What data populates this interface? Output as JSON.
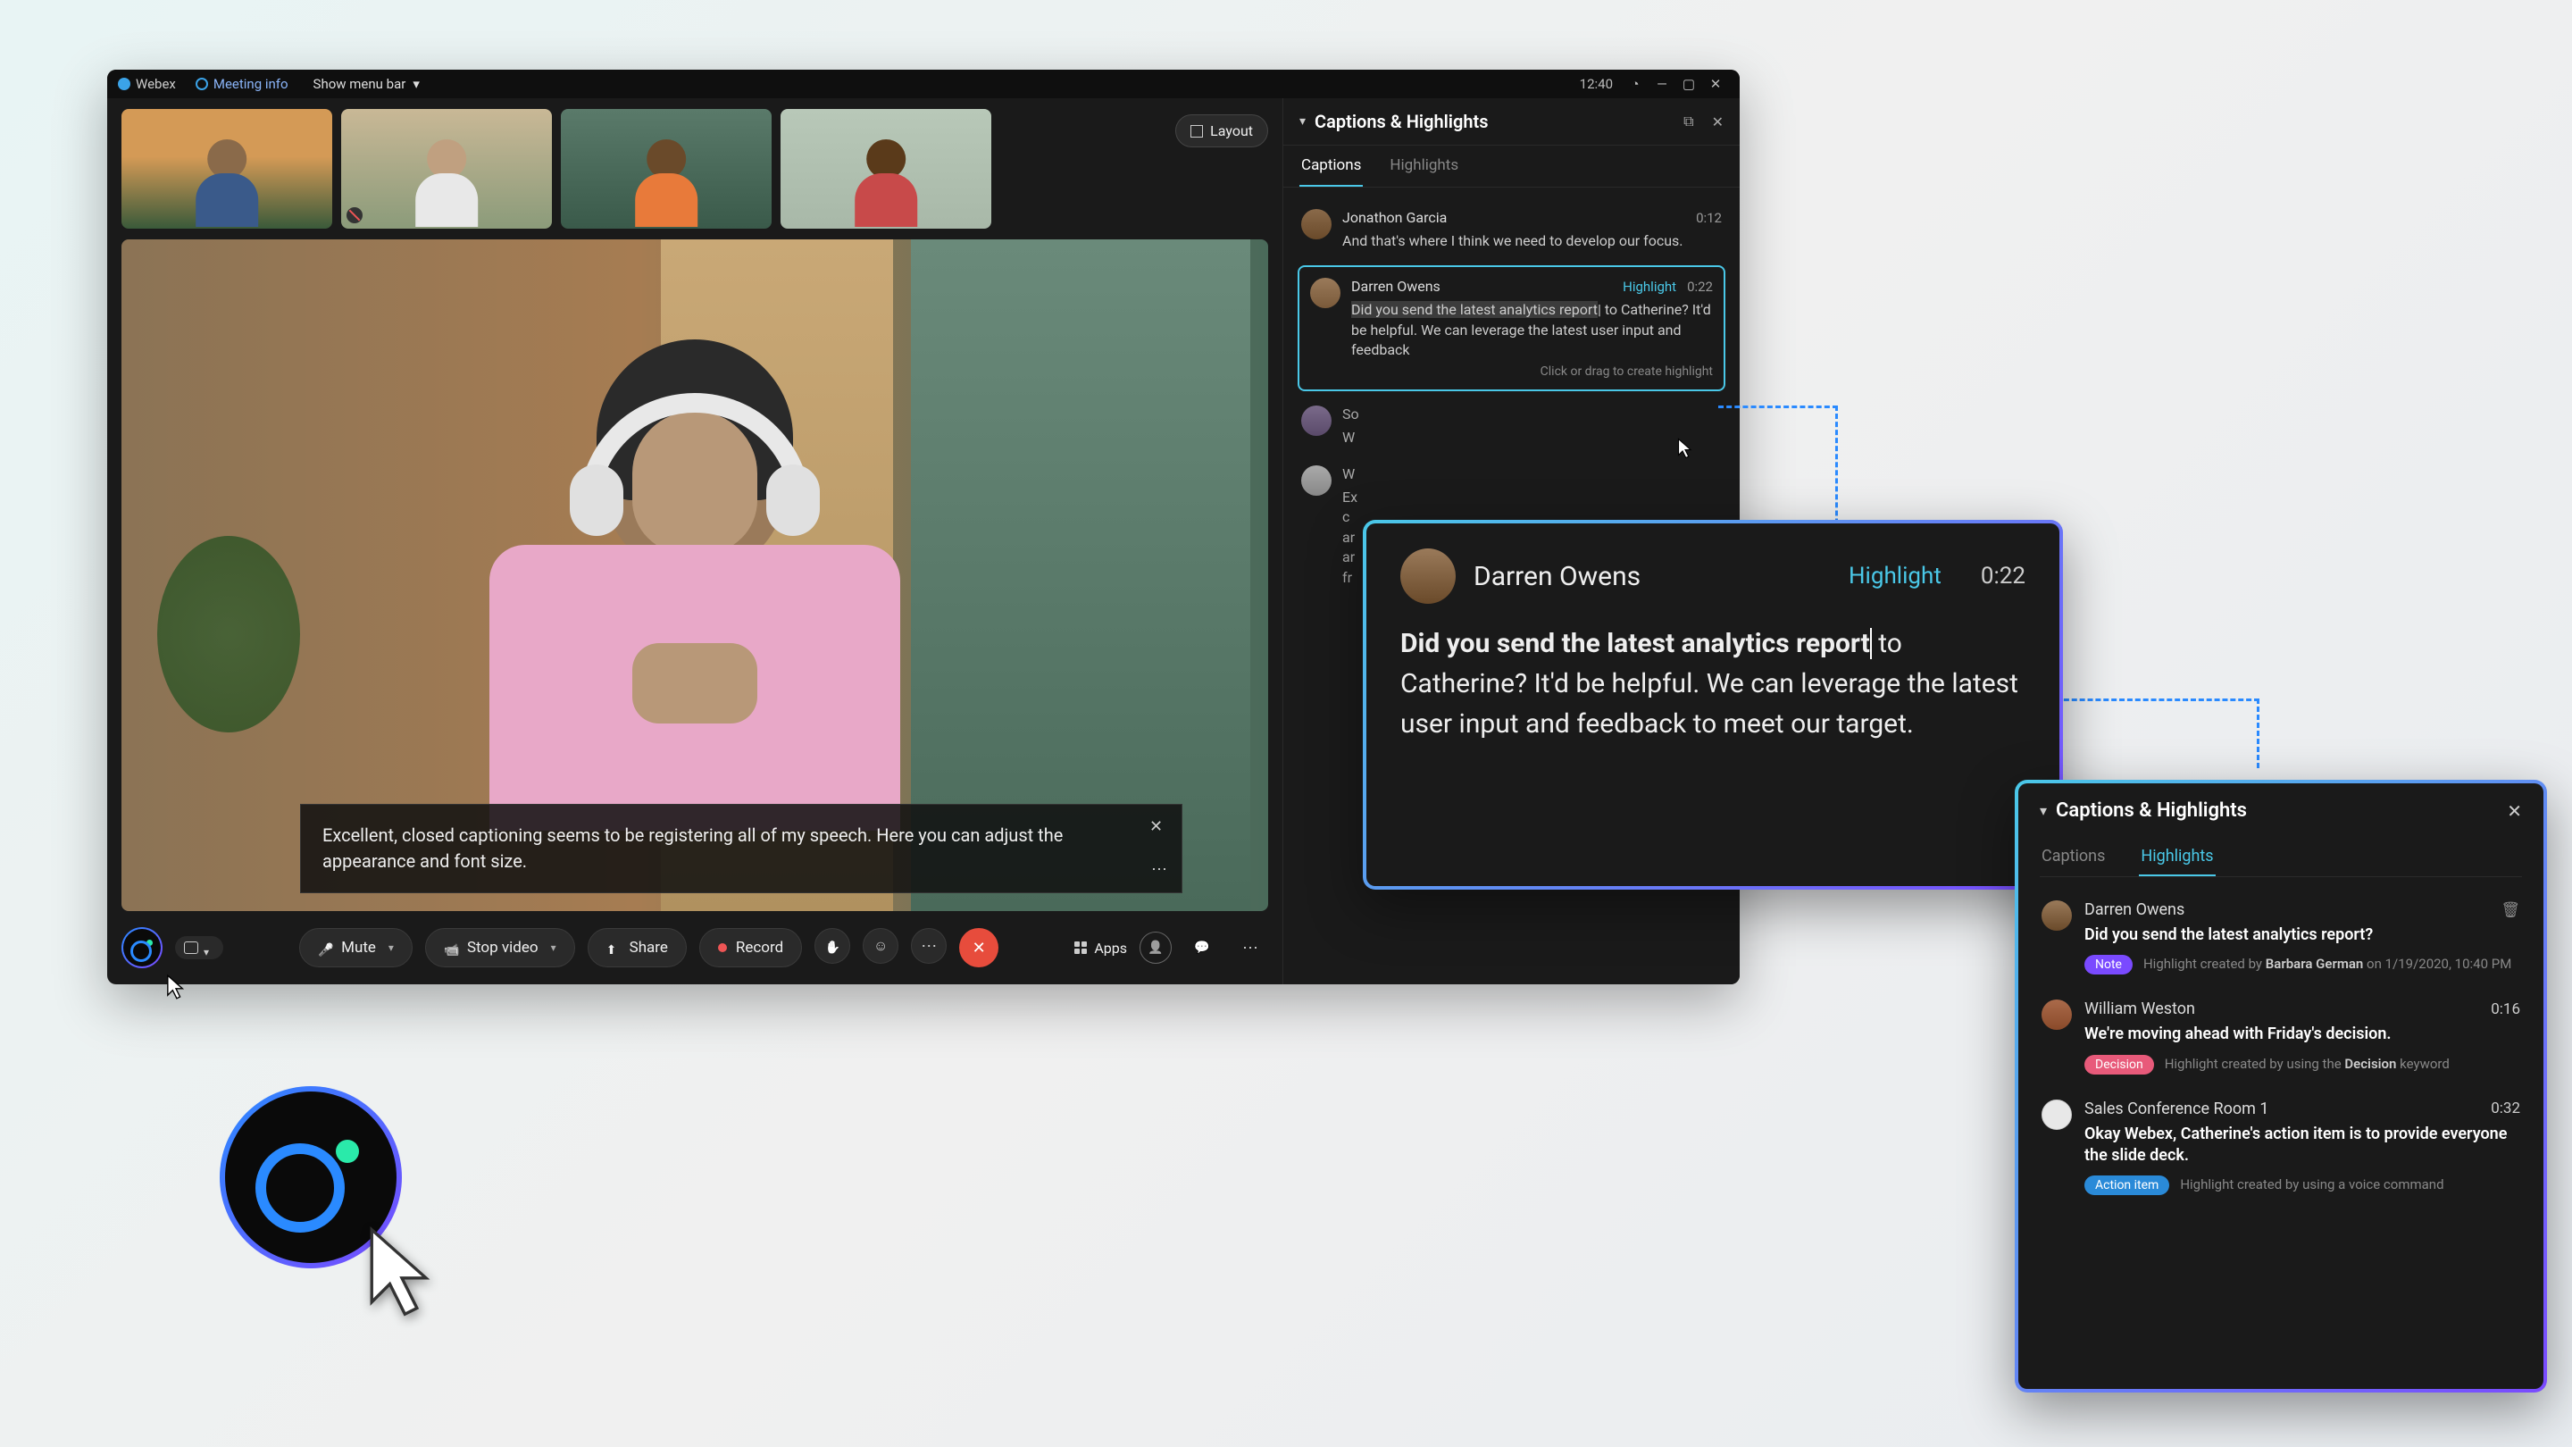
{
  "titlebar": {
    "brand": "Webex",
    "meeting_info": "Meeting info",
    "show_menu": "Show menu bar",
    "time": "12:40"
  },
  "layout_btn": "Layout",
  "caption_live": "Excellent, closed captioning seems to be registering all of my speech. Here you can adjust the appearance and font size.",
  "controls": {
    "mute": "Mute",
    "stop_video": "Stop video",
    "share": "Share",
    "record": "Record",
    "apps": "Apps"
  },
  "panel": {
    "title": "Captions & Highlights",
    "tab_captions": "Captions",
    "tab_highlights": "Highlights",
    "tooltip": "Click or drag to create highlight",
    "items": [
      {
        "name": "Jonathon Garcia",
        "time": "0:12",
        "text": "And that's where I think we need to develop our focus."
      },
      {
        "name": "Darren Owens",
        "hl": "Highlight",
        "time": "0:22",
        "text_sel": "Did you send the latest analytics report",
        "text_rest": " to Catherine? It'd be helpful. We can leverage the latest user input and feedback"
      },
      {
        "name": "So",
        "time": "",
        "text": "W"
      },
      {
        "name": "W",
        "time": "",
        "text_a": "Ex",
        "text_b": "c",
        "text_c": "ar",
        "text_d": "ar",
        "text_e": "fr"
      }
    ]
  },
  "zoom": {
    "name": "Darren Owens",
    "hl": "Highlight",
    "time": "0:22",
    "text_bold": "Did you send the latest analytics report",
    "text_rest": "to Catherine? It'd be helpful. We can leverage the latest user input and feedback to meet our target."
  },
  "hl_panel": {
    "title": "Captions & Highlights",
    "tab_captions": "Captions",
    "tab_highlights": "Highlights",
    "items": [
      {
        "name": "Darren Owens",
        "quote": "Did you send the latest analytics report?",
        "pill": "Note",
        "sub_pre": "Highlight created by ",
        "sub_bold": "Barbara German",
        "sub_post": " on 1/19/2020, 10:40 PM"
      },
      {
        "name": "William Weston",
        "time": "0:16",
        "quote": "We're moving ahead with Friday's decision.",
        "pill": "Decision",
        "sub_pre": "Highlight created by using the ",
        "sub_bold": "Decision",
        "sub_post": " keyword"
      },
      {
        "name": "Sales Conference Room 1",
        "time": "0:32",
        "quote": "Okay Webex, Catherine's action item is to provide everyone the slide deck.",
        "pill": "Action item",
        "sub_pre": "Highlight created by using a voice command",
        "sub_bold": "",
        "sub_post": ""
      }
    ]
  }
}
